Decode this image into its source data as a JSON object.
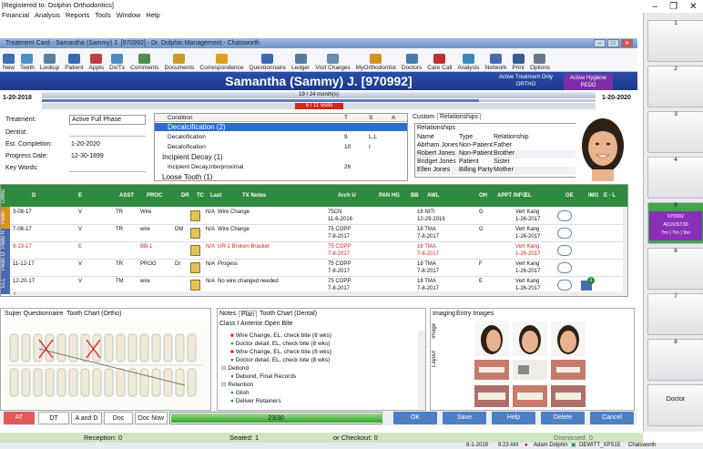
{
  "app": {
    "title": "[Registered to: Dolphin Orthodontics]",
    "window_controls": [
      "–",
      "❐",
      "✕"
    ]
  },
  "menu": [
    "Financial",
    "Analysis",
    "Reports",
    "Tools",
    "Window",
    "Help"
  ],
  "window": {
    "title": "Treatment Card - Samantha (Sammy) J. [970992] - Dr. Dolphin Management - Chatsworth"
  },
  "toolbar": [
    "New",
    "Teeth",
    "Lookup",
    "Patient",
    "Appts",
    "Dx/Tx",
    "Comments",
    "Documents",
    "Correspondence",
    "Questionnaire",
    "Ledger",
    "Visit Charges",
    "MyOrthodontist",
    "Doctors",
    "Care Call",
    "Analysis",
    "Network",
    "Print",
    "Options"
  ],
  "patient": {
    "name": "Samantha (Sammy) J. [970992]",
    "tx_only": "Active Treatment Only",
    "tx_only_sub": "ORTHO",
    "hygiene": "Active Hygiene",
    "hygiene_sub": "PEDO"
  },
  "timeline": {
    "start": "1-20-2018",
    "end": "1-20-2020",
    "months": "19 / 24 month(s)",
    "visits": "6 / 11 visits",
    "progress_fraction": 0.79
  },
  "info": {
    "treatment_label": "Treatment:",
    "treatment": "Active Full Phase",
    "dentist_label": "Dentist:",
    "est_label": "Est. Completion:",
    "est": "1-20-2020",
    "progress_label": "Progress Date:",
    "progress": "12-30-1899",
    "keywords_label": "Key Words:"
  },
  "condition": {
    "headers": [
      "Condition",
      "T",
      "S",
      "A"
    ],
    "rows": [
      {
        "text": "Decalcification  (2)",
        "t": "",
        "s": "",
        "style": "sel"
      },
      {
        "text": "Decalcification",
        "t": "9",
        "s": "L,L",
        "style": "sub"
      },
      {
        "text": "Decalcification",
        "t": "10",
        "s": "I",
        "style": "sub"
      },
      {
        "text": "Incipient Decay  (1)",
        "t": "",
        "s": "",
        "style": "grp"
      },
      {
        "text": "Incipient Decay,Interproximal",
        "t": "26",
        "s": "",
        "style": "sub"
      },
      {
        "text": "Loose Tooth  (1)",
        "t": "",
        "s": "",
        "style": "grp"
      }
    ]
  },
  "relationships": {
    "tabs": [
      "Custom",
      "Relationships"
    ],
    "title": "Relationships",
    "headers": [
      "Name",
      "Type",
      "Relationship"
    ],
    "rows": [
      [
        "Abrham Jones",
        "Non-Patient",
        "Father"
      ],
      [
        "Robert Jones",
        "Non-Patient",
        "Brother"
      ],
      [
        "Bridget Jones",
        "Patient",
        "Sister"
      ],
      [
        "Ellen Jones",
        "Billing Party",
        "Mother"
      ]
    ]
  },
  "grid": {
    "vtabs": [
      "Ortho",
      "Pedo",
      "Pedo R",
      "Pedo O",
      "ELL"
    ],
    "headers": [
      "D",
      "E",
      "ASST",
      "PROC",
      "DR",
      "TC",
      "Last",
      "TX Notes",
      "Arch U",
      "PAN HG",
      "BB",
      "AWL",
      "OH",
      "APPT INFO",
      "EL",
      "OE",
      "IMG",
      "E - L"
    ],
    "rows": [
      {
        "d": "3-08-17",
        "e": "V",
        "asst": "TR",
        "proc": "Wire",
        "dr": "",
        "last": "N/A",
        "notes": "Wire Change",
        "arch1": "75CN",
        "arch2": "11-6-2016",
        "awl1": "18 NITI",
        "awl2": "12-29-2016",
        "oh": "G",
        "el1": "Vert Kang",
        "el2": "1-26-2017",
        "red": false,
        "img": ""
      },
      {
        "d": "7-08-17",
        "e": "V",
        "asst": "TR",
        "proc": "wire",
        "dr": "DM",
        "last": "N/A",
        "notes": "Wire Change",
        "arch1": "75 COPP",
        "arch2": "7-8-2017",
        "awl1": "18 TMA",
        "awl2": "7-8-2017",
        "oh": "G",
        "el1": "Vert Kang",
        "el2": "1-26-2017",
        "red": false,
        "img": ""
      },
      {
        "d": "9-13-17",
        "e": "E",
        "asst": "",
        "proc": "BB-1",
        "dr": "",
        "last": "N/A",
        "notes": "UR-1 Broken Bracket",
        "arch1": "75 COPP",
        "arch2": "7-8-2017",
        "awl1": "18 TMA",
        "awl2": "7-8-2017",
        "oh": "",
        "el1": "Vert Kang",
        "el2": "1-26-2017",
        "red": true,
        "img": ""
      },
      {
        "d": "11-12-17",
        "e": "V",
        "asst": "TR",
        "proc": "PROG",
        "dr": "DI",
        "last": "N/A",
        "notes": "Progess",
        "arch1": "75 COPP",
        "arch2": "7-8-2017",
        "awl1": "18 TMA",
        "awl2": "7-8-2017",
        "oh": "F",
        "el1": "Vert Kang",
        "el2": "1-26-2017",
        "red": false,
        "img": ""
      },
      {
        "d": "12-20-17",
        "e": "V",
        "asst": "TM",
        "proc": "wire",
        "dr": "",
        "last": "N/A",
        "notes": "No wire changed needed",
        "arch1": "75 COPP",
        "arch2": "7-8-2017",
        "awl1": "18 TMA",
        "awl2": "7-8-2017",
        "oh": "E",
        "el1": "Vert Kang",
        "el2": "1-26-2017",
        "red": false,
        "img": "1"
      }
    ]
  },
  "lower_left": {
    "tabs": [
      "Super Questionnaire",
      "Tooth Chart (Ortho)"
    ]
  },
  "lower_mid": {
    "tabs": [
      "Notes",
      "Plan",
      "Tooth Chart (Dental)"
    ],
    "subtitle": "Class I Anterior Open Bite",
    "items": [
      {
        "text": "Wire Change, EL, check bite (8 wks)",
        "kind": "red",
        "indent": 1
      },
      {
        "text": "Doctor detail, EL, check bite (8 wks)",
        "kind": "green",
        "indent": 1
      },
      {
        "text": "Wire Change, EL, check bite (8 wks)",
        "kind": "red",
        "indent": 1
      },
      {
        "text": "Doctor detail, EL, check bite (8 wks)",
        "kind": "green",
        "indent": 1
      },
      {
        "text": "Debond",
        "kind": "grp",
        "indent": 0
      },
      {
        "text": "Debond, Final Records",
        "kind": "green",
        "indent": 1
      },
      {
        "text": "Retention",
        "kind": "grp",
        "indent": 0
      },
      {
        "text": "Glish",
        "kind": "green",
        "indent": 1
      },
      {
        "text": "Deliver Retainers",
        "kind": "green",
        "indent": 1
      }
    ]
  },
  "lower_right": {
    "tabs": [
      "Imaging",
      "Entry Images"
    ],
    "side_labels": [
      "Image",
      "Layout"
    ]
  },
  "buttons": {
    "at": "AT",
    "dt": "DT",
    "a_and_d": "A and D",
    "doc": "Doc",
    "doc_now": "Doc Now",
    "progress": "23/30",
    "ok": "OK",
    "save": "Save",
    "help": "Help",
    "delete": "Delete",
    "cancel": "Cancel"
  },
  "status": {
    "reception": "Reception: 0",
    "seated": "Seated: 1",
    "checkout": "or Checkout: 0",
    "dismissed": "Dismissed: 0"
  },
  "footer": {
    "date": "8-1-2019",
    "time": "9:23 AM",
    "user": "Adam Dolphin",
    "machine": "DEWITT_XPS15",
    "location": "Chatsworth"
  },
  "right_panel": {
    "slots": [
      "1",
      "2",
      "3",
      "4",
      "5",
      "6",
      "7",
      "8",
      "Doctor"
    ],
    "active_slot": "5",
    "active_card": {
      "line1": "970992",
      "line2": "ADJUST30",
      "line3": "7m | 7m | 9m"
    }
  },
  "colors": {
    "accent_blue": "#1b3a8c",
    "grid_green": "#2d8a3e",
    "alert_red": "#d7261e",
    "hygiene_purple": "#7a2fa8"
  }
}
